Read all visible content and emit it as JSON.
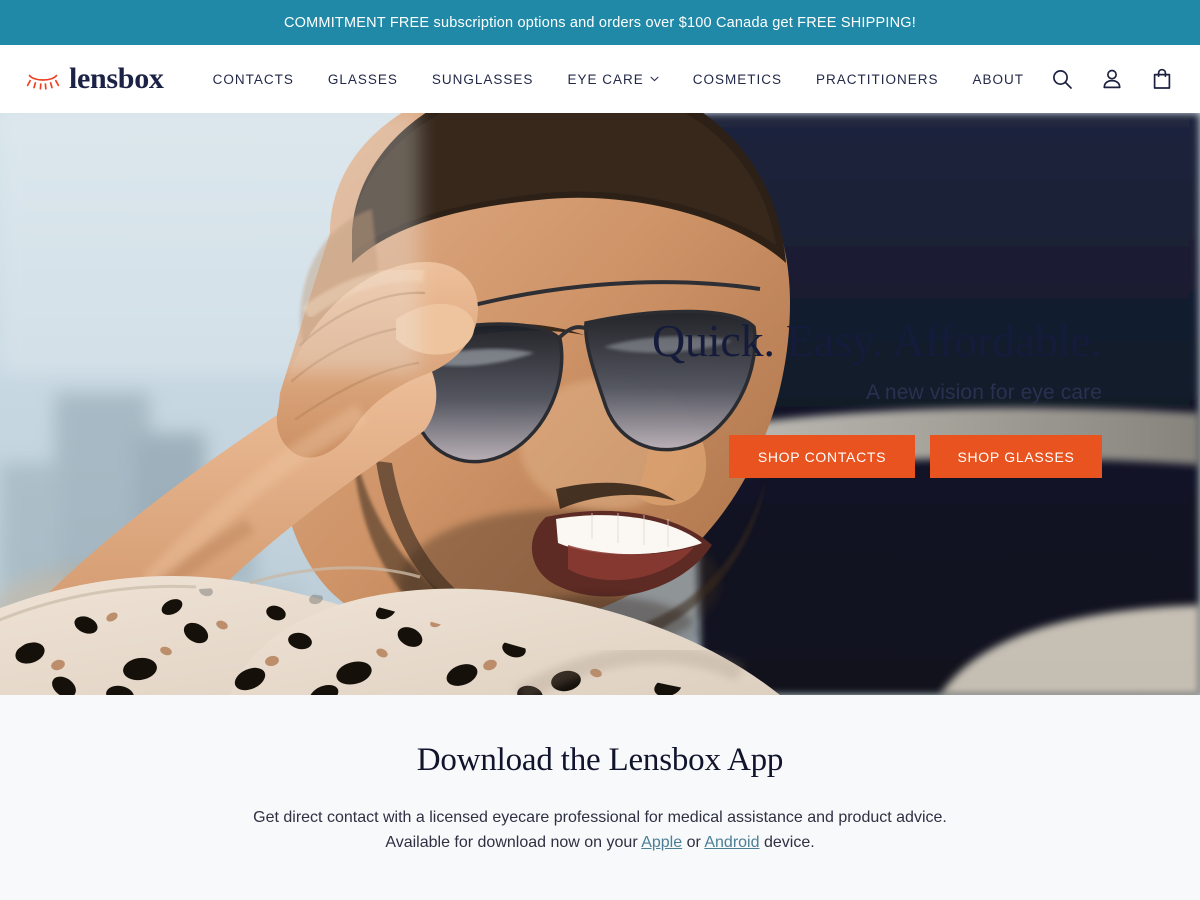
{
  "announcement": {
    "text": "COMMITMENT FREE subscription options and orders over $100 Canada get FREE SHIPPING!",
    "background": "#1f89a7",
    "color": "#ffffff"
  },
  "header": {
    "brand": {
      "name": "lensbox",
      "mark_icon": "eyelash-icon",
      "mark_color": "#ef4123",
      "name_color": "#1c2246"
    },
    "nav": [
      {
        "label": "CONTACTS",
        "has_dropdown": false
      },
      {
        "label": "GLASSES",
        "has_dropdown": false
      },
      {
        "label": "SUNGLASSES",
        "has_dropdown": false
      },
      {
        "label": "EYE CARE",
        "has_dropdown": true,
        "dropdown_icon": "chevron-down-icon"
      },
      {
        "label": "COSMETICS",
        "has_dropdown": false
      },
      {
        "label": "PRACTITIONERS",
        "has_dropdown": false
      },
      {
        "label": "ABOUT",
        "has_dropdown": false
      }
    ],
    "actions": [
      {
        "icon": "search-icon"
      },
      {
        "icon": "account-icon"
      },
      {
        "icon": "shopping-bag-icon"
      }
    ]
  },
  "hero": {
    "image_description": "Smiling man with short beard lowering aviator sunglasses, wearing a leopard-print shirt, blurred city skyline and sky behind, dark navy car interior at right",
    "title": "Quick. Easy. Affordable.",
    "subtitle": "A new vision for eye care",
    "buttons": [
      {
        "label": "SHOP CONTACTS",
        "color": "#e8531f"
      },
      {
        "label": "SHOP GLASSES",
        "color": "#e8531f"
      }
    ]
  },
  "download": {
    "title": "Download the Lensbox App",
    "body_before": "Get direct contact with a licensed eyecare professional for medical assistance and product advice. Available for download now on your ",
    "link_apple": "Apple",
    "body_between": " or ",
    "link_android": "Android",
    "body_after": " device.",
    "link_color": "#4a7f95",
    "background": "#f8f9fb"
  }
}
